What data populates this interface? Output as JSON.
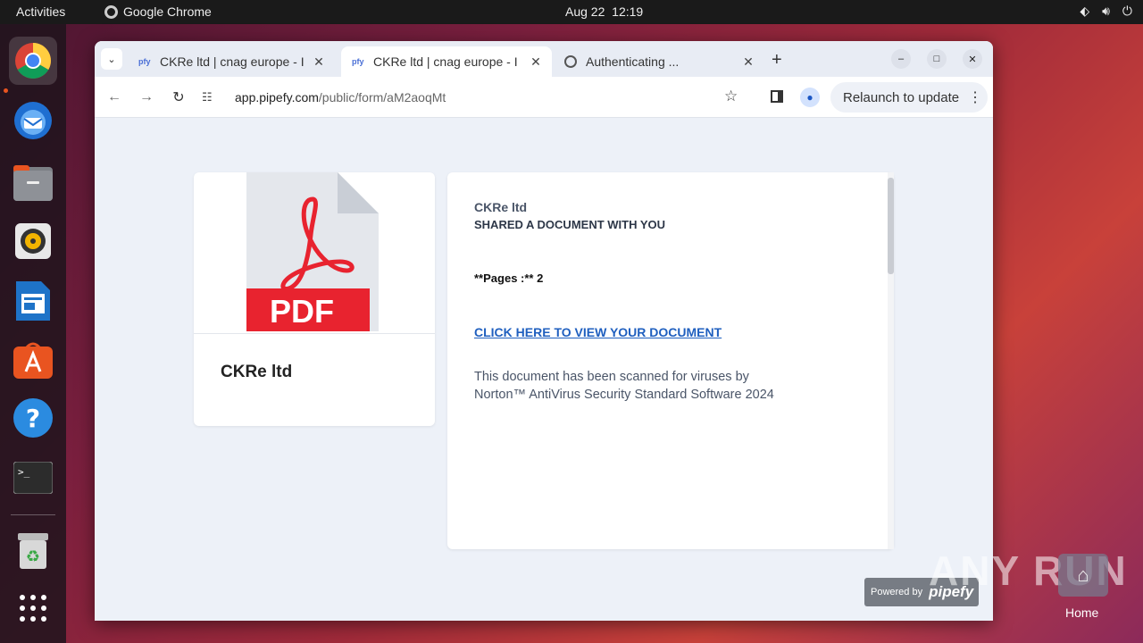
{
  "topbar": {
    "activities": "Activities",
    "app_name": "Google Chrome",
    "date": "Aug 22",
    "time": "12:19"
  },
  "dock": {
    "items": [
      "chrome-icon",
      "thunderbird-icon",
      "files-icon",
      "rhythmbox-icon",
      "writer-icon",
      "app-center-icon",
      "help-icon",
      "terminal-icon",
      "trash-icon",
      "app-grid-icon"
    ]
  },
  "tabs": [
    {
      "favicon": "pfy",
      "title": "CKRe ltd | cnag europe - I",
      "close": "✕"
    },
    {
      "favicon": "pfy",
      "title": "CKRe ltd | cnag europe - I",
      "close": "✕"
    },
    {
      "favicon": "globe",
      "title": "Authenticating ...",
      "close": "✕"
    }
  ],
  "toolbar": {
    "url_host": "app.pipefy.com",
    "url_path": "/public/form/aM2aoqMt",
    "relaunch": "Relaunch to update"
  },
  "left_card": {
    "pdf_label": "PDF",
    "company": "CKRe ltd"
  },
  "right_card": {
    "sender": "CKRe ltd",
    "shared": "SHARED A DOCUMENT WITH YOU",
    "pages": "**Pages :** 2",
    "link": "CLICK HERE TO VIEW YOUR DOCUMENT",
    "scan_line1": "This document has been scanned for viruses by",
    "scan_line2": "Norton™ AntiVirus Security Standard Software 2024"
  },
  "powered": {
    "prefix": "Powered by",
    "brand": "pipefy"
  },
  "desktop": {
    "home_label": "Home",
    "watermark": "ANY RUN"
  },
  "colors": {
    "accent_link": "#1f5fbf",
    "pdf_red": "#e8232f",
    "dock_running": "#e95420"
  }
}
